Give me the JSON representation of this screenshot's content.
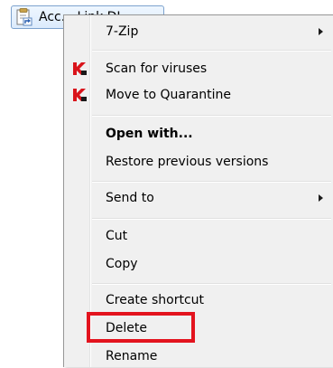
{
  "file_item": {
    "name": "Acc... Link DL..."
  },
  "context_menu": {
    "items": [
      {
        "label": "7-Zip",
        "submenu": true,
        "icon": ""
      },
      {
        "label": "Scan for viruses",
        "submenu": false,
        "icon": "kaspersky-k-icon"
      },
      {
        "label": "Move to Quarantine",
        "submenu": false,
        "icon": "kaspersky-k-icon"
      },
      {
        "label": "Open with...",
        "submenu": false,
        "bold": true,
        "icon": ""
      },
      {
        "label": "Restore previous versions",
        "submenu": false,
        "icon": ""
      },
      {
        "label": "Send to",
        "submenu": true,
        "icon": ""
      },
      {
        "label": "Cut",
        "submenu": false,
        "icon": ""
      },
      {
        "label": "Copy",
        "submenu": false,
        "icon": ""
      },
      {
        "label": "Create shortcut",
        "submenu": false,
        "icon": ""
      },
      {
        "label": "Delete",
        "submenu": false,
        "highlighted": true,
        "icon": ""
      },
      {
        "label": "Rename",
        "submenu": false,
        "icon": ""
      }
    ]
  },
  "colors": {
    "menu_background": "#f0f0f0",
    "highlight_border": "#e3131e",
    "kaspersky_red": "#d9141b",
    "kaspersky_black": "#1a1a1a"
  }
}
